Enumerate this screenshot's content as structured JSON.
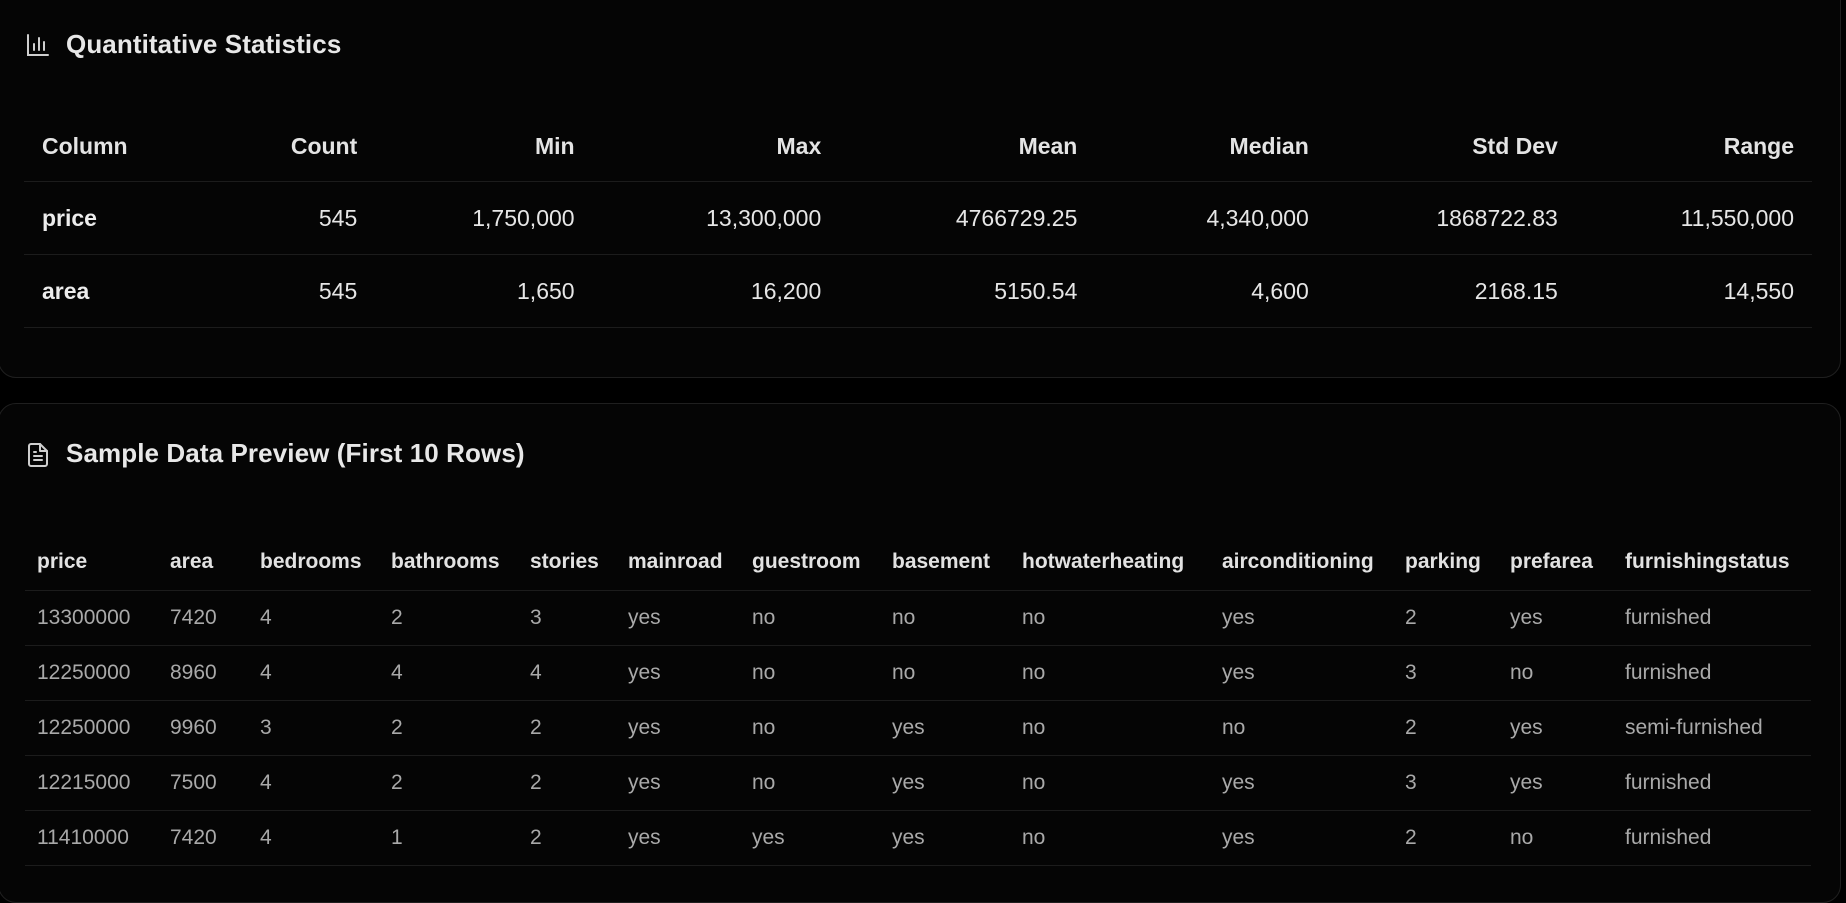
{
  "stats": {
    "title": "Quantitative Statistics",
    "icon": "bar-chart-icon",
    "headers": [
      "Column",
      "Count",
      "Min",
      "Max",
      "Mean",
      "Median",
      "Std Dev",
      "Range"
    ],
    "rows": [
      [
        "price",
        "545",
        "1,750,000",
        "13,300,000",
        "4766729.25",
        "4,340,000",
        "1868722.83",
        "11,550,000"
      ],
      [
        "area",
        "545",
        "1,650",
        "16,200",
        "5150.54",
        "4,600",
        "2168.15",
        "14,550"
      ]
    ]
  },
  "preview": {
    "title": "Sample Data Preview (First 10 Rows)",
    "icon": "document-icon",
    "headers": [
      "price",
      "area",
      "bedrooms",
      "bathrooms",
      "stories",
      "mainroad",
      "guestroom",
      "basement",
      "hotwaterheating",
      "airconditioning",
      "parking",
      "prefarea",
      "furnishingstatus"
    ],
    "rows": [
      [
        "13300000",
        "7420",
        "4",
        "2",
        "3",
        "yes",
        "no",
        "no",
        "no",
        "yes",
        "2",
        "yes",
        "furnished"
      ],
      [
        "12250000",
        "8960",
        "4",
        "4",
        "4",
        "yes",
        "no",
        "no",
        "no",
        "yes",
        "3",
        "no",
        "furnished"
      ],
      [
        "12250000",
        "9960",
        "3",
        "2",
        "2",
        "yes",
        "no",
        "yes",
        "no",
        "no",
        "2",
        "yes",
        "semi-furnished"
      ],
      [
        "12215000",
        "7500",
        "4",
        "2",
        "2",
        "yes",
        "no",
        "yes",
        "no",
        "yes",
        "3",
        "yes",
        "furnished"
      ],
      [
        "11410000",
        "7420",
        "4",
        "1",
        "2",
        "yes",
        "yes",
        "yes",
        "no",
        "yes",
        "2",
        "no",
        "furnished"
      ]
    ]
  },
  "colors": {
    "background": "#000000",
    "card": "#050505",
    "border": "#1f1f1f",
    "text": "#e6e6e6",
    "muted_text": "#a9a9a9"
  }
}
